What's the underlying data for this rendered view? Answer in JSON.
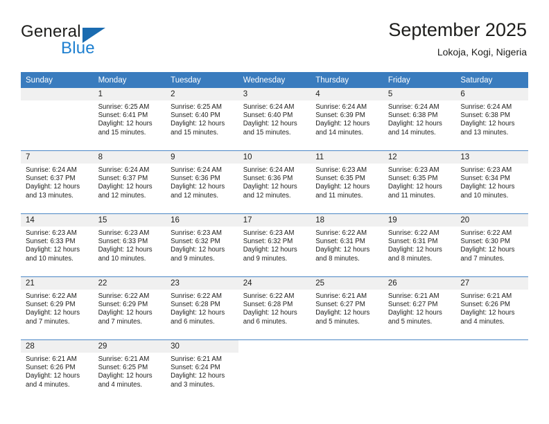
{
  "brand": {
    "line1": "General",
    "line2": "Blue",
    "triangle_color": "#1a6bb0",
    "blue_color": "#1d7fd0"
  },
  "header": {
    "title": "September 2025",
    "subtitle": "Lokoja, Kogi, Nigeria",
    "header_bg": "#3a7cbe",
    "header_text_color": "#ffffff",
    "daynum_band_bg": "#f0f0f0",
    "row_divider_color": "#4a86c5"
  },
  "columns": [
    "Sunday",
    "Monday",
    "Tuesday",
    "Wednesday",
    "Thursday",
    "Friday",
    "Saturday"
  ],
  "weeks": [
    [
      {
        "day": "",
        "lines": []
      },
      {
        "day": "1",
        "lines": [
          "Sunrise: 6:25 AM",
          "Sunset: 6:41 PM",
          "Daylight: 12 hours",
          "and 15 minutes."
        ]
      },
      {
        "day": "2",
        "lines": [
          "Sunrise: 6:25 AM",
          "Sunset: 6:40 PM",
          "Daylight: 12 hours",
          "and 15 minutes."
        ]
      },
      {
        "day": "3",
        "lines": [
          "Sunrise: 6:24 AM",
          "Sunset: 6:40 PM",
          "Daylight: 12 hours",
          "and 15 minutes."
        ]
      },
      {
        "day": "4",
        "lines": [
          "Sunrise: 6:24 AM",
          "Sunset: 6:39 PM",
          "Daylight: 12 hours",
          "and 14 minutes."
        ]
      },
      {
        "day": "5",
        "lines": [
          "Sunrise: 6:24 AM",
          "Sunset: 6:38 PM",
          "Daylight: 12 hours",
          "and 14 minutes."
        ]
      },
      {
        "day": "6",
        "lines": [
          "Sunrise: 6:24 AM",
          "Sunset: 6:38 PM",
          "Daylight: 12 hours",
          "and 13 minutes."
        ]
      }
    ],
    [
      {
        "day": "7",
        "lines": [
          "Sunrise: 6:24 AM",
          "Sunset: 6:37 PM",
          "Daylight: 12 hours",
          "and 13 minutes."
        ]
      },
      {
        "day": "8",
        "lines": [
          "Sunrise: 6:24 AM",
          "Sunset: 6:37 PM",
          "Daylight: 12 hours",
          "and 12 minutes."
        ]
      },
      {
        "day": "9",
        "lines": [
          "Sunrise: 6:24 AM",
          "Sunset: 6:36 PM",
          "Daylight: 12 hours",
          "and 12 minutes."
        ]
      },
      {
        "day": "10",
        "lines": [
          "Sunrise: 6:24 AM",
          "Sunset: 6:36 PM",
          "Daylight: 12 hours",
          "and 12 minutes."
        ]
      },
      {
        "day": "11",
        "lines": [
          "Sunrise: 6:23 AM",
          "Sunset: 6:35 PM",
          "Daylight: 12 hours",
          "and 11 minutes."
        ]
      },
      {
        "day": "12",
        "lines": [
          "Sunrise: 6:23 AM",
          "Sunset: 6:35 PM",
          "Daylight: 12 hours",
          "and 11 minutes."
        ]
      },
      {
        "day": "13",
        "lines": [
          "Sunrise: 6:23 AM",
          "Sunset: 6:34 PM",
          "Daylight: 12 hours",
          "and 10 minutes."
        ]
      }
    ],
    [
      {
        "day": "14",
        "lines": [
          "Sunrise: 6:23 AM",
          "Sunset: 6:33 PM",
          "Daylight: 12 hours",
          "and 10 minutes."
        ]
      },
      {
        "day": "15",
        "lines": [
          "Sunrise: 6:23 AM",
          "Sunset: 6:33 PM",
          "Daylight: 12 hours",
          "and 10 minutes."
        ]
      },
      {
        "day": "16",
        "lines": [
          "Sunrise: 6:23 AM",
          "Sunset: 6:32 PM",
          "Daylight: 12 hours",
          "and 9 minutes."
        ]
      },
      {
        "day": "17",
        "lines": [
          "Sunrise: 6:23 AM",
          "Sunset: 6:32 PM",
          "Daylight: 12 hours",
          "and 9 minutes."
        ]
      },
      {
        "day": "18",
        "lines": [
          "Sunrise: 6:22 AM",
          "Sunset: 6:31 PM",
          "Daylight: 12 hours",
          "and 8 minutes."
        ]
      },
      {
        "day": "19",
        "lines": [
          "Sunrise: 6:22 AM",
          "Sunset: 6:31 PM",
          "Daylight: 12 hours",
          "and 8 minutes."
        ]
      },
      {
        "day": "20",
        "lines": [
          "Sunrise: 6:22 AM",
          "Sunset: 6:30 PM",
          "Daylight: 12 hours",
          "and 7 minutes."
        ]
      }
    ],
    [
      {
        "day": "21",
        "lines": [
          "Sunrise: 6:22 AM",
          "Sunset: 6:29 PM",
          "Daylight: 12 hours",
          "and 7 minutes."
        ]
      },
      {
        "day": "22",
        "lines": [
          "Sunrise: 6:22 AM",
          "Sunset: 6:29 PM",
          "Daylight: 12 hours",
          "and 7 minutes."
        ]
      },
      {
        "day": "23",
        "lines": [
          "Sunrise: 6:22 AM",
          "Sunset: 6:28 PM",
          "Daylight: 12 hours",
          "and 6 minutes."
        ]
      },
      {
        "day": "24",
        "lines": [
          "Sunrise: 6:22 AM",
          "Sunset: 6:28 PM",
          "Daylight: 12 hours",
          "and 6 minutes."
        ]
      },
      {
        "day": "25",
        "lines": [
          "Sunrise: 6:21 AM",
          "Sunset: 6:27 PM",
          "Daylight: 12 hours",
          "and 5 minutes."
        ]
      },
      {
        "day": "26",
        "lines": [
          "Sunrise: 6:21 AM",
          "Sunset: 6:27 PM",
          "Daylight: 12 hours",
          "and 5 minutes."
        ]
      },
      {
        "day": "27",
        "lines": [
          "Sunrise: 6:21 AM",
          "Sunset: 6:26 PM",
          "Daylight: 12 hours",
          "and 4 minutes."
        ]
      }
    ],
    [
      {
        "day": "28",
        "lines": [
          "Sunrise: 6:21 AM",
          "Sunset: 6:26 PM",
          "Daylight: 12 hours",
          "and 4 minutes."
        ]
      },
      {
        "day": "29",
        "lines": [
          "Sunrise: 6:21 AM",
          "Sunset: 6:25 PM",
          "Daylight: 12 hours",
          "and 4 minutes."
        ]
      },
      {
        "day": "30",
        "lines": [
          "Sunrise: 6:21 AM",
          "Sunset: 6:24 PM",
          "Daylight: 12 hours",
          "and 3 minutes."
        ]
      },
      {
        "day": "",
        "lines": []
      },
      {
        "day": "",
        "lines": []
      },
      {
        "day": "",
        "lines": []
      },
      {
        "day": "",
        "lines": []
      }
    ]
  ]
}
